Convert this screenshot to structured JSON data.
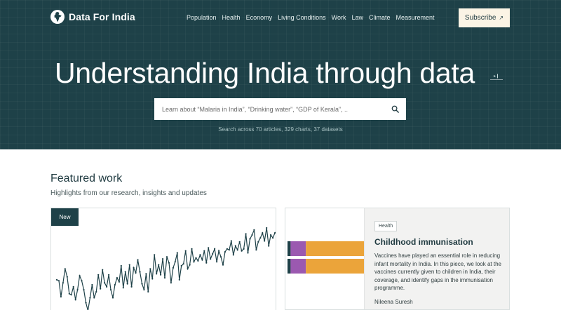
{
  "brand": {
    "name": "Data For India"
  },
  "nav": {
    "items": [
      {
        "label": "Population"
      },
      {
        "label": "Health"
      },
      {
        "label": "Economy"
      },
      {
        "label": "Living Conditions"
      },
      {
        "label": "Work"
      },
      {
        "label": "Law"
      },
      {
        "label": "Climate"
      },
      {
        "label": "Measurement"
      }
    ],
    "subscribe_label": "Subscribe",
    "subscribe_icon": "arrow-up-right-icon"
  },
  "hero": {
    "title": "Understanding India through data",
    "control_glyph": "▸❙",
    "search_placeholder": "Learn about “Malaria in India”, “Drinking water”, “GDP of Kerala”, ..",
    "search_icon": "search-icon",
    "search_hint": "Search across 70 articles, 329 charts, 37 datasets"
  },
  "featured": {
    "title": "Featured work",
    "subtitle": "Highlights from our research, insights and updates",
    "chart_card": {
      "badge": "New",
      "line_color": "#1e4148",
      "series": [
        41,
        40,
        24,
        38,
        52,
        44,
        27,
        26,
        34,
        21,
        31,
        45,
        40,
        31,
        18,
        10,
        23,
        36,
        23,
        29,
        46,
        32,
        51,
        38,
        34,
        46,
        31,
        23,
        36,
        43,
        39,
        55,
        33,
        49,
        37,
        56,
        34,
        53,
        48,
        61,
        49,
        37,
        31,
        47,
        29,
        52,
        42,
        66,
        47,
        56,
        46,
        62,
        43,
        64,
        58,
        38,
        53,
        59,
        68,
        41,
        55,
        57,
        70,
        52,
        56,
        72,
        59,
        63,
        60,
        66,
        61,
        70,
        58,
        73,
        62,
        67,
        72,
        59,
        70,
        64,
        56,
        69,
        72,
        71,
        80,
        66,
        75,
        71,
        79,
        70,
        72,
        87,
        68,
        82,
        86,
        91,
        71,
        79,
        83,
        88,
        80,
        93,
        75,
        86,
        83,
        88,
        90
      ]
    },
    "article_card": {
      "tag": "Health",
      "title": "Childhood immunisation",
      "description": "Vaccines have played an essential role in reducing infant mortality in India. In this piece, we look at the vaccines currently given to children in India, their coverage, and identify gaps in the immunisation programme.",
      "author": "Nileena Suresh",
      "bar_colors": {
        "dark": "#1e4148",
        "purple": "#9b59b0",
        "orange": "#eba43a"
      },
      "bars": [
        {
          "dark": 0.04,
          "purple": 0.2,
          "orange": 0.76
        },
        {
          "dark": 0.04,
          "purple": 0.2,
          "orange": 0.76
        }
      ]
    }
  }
}
